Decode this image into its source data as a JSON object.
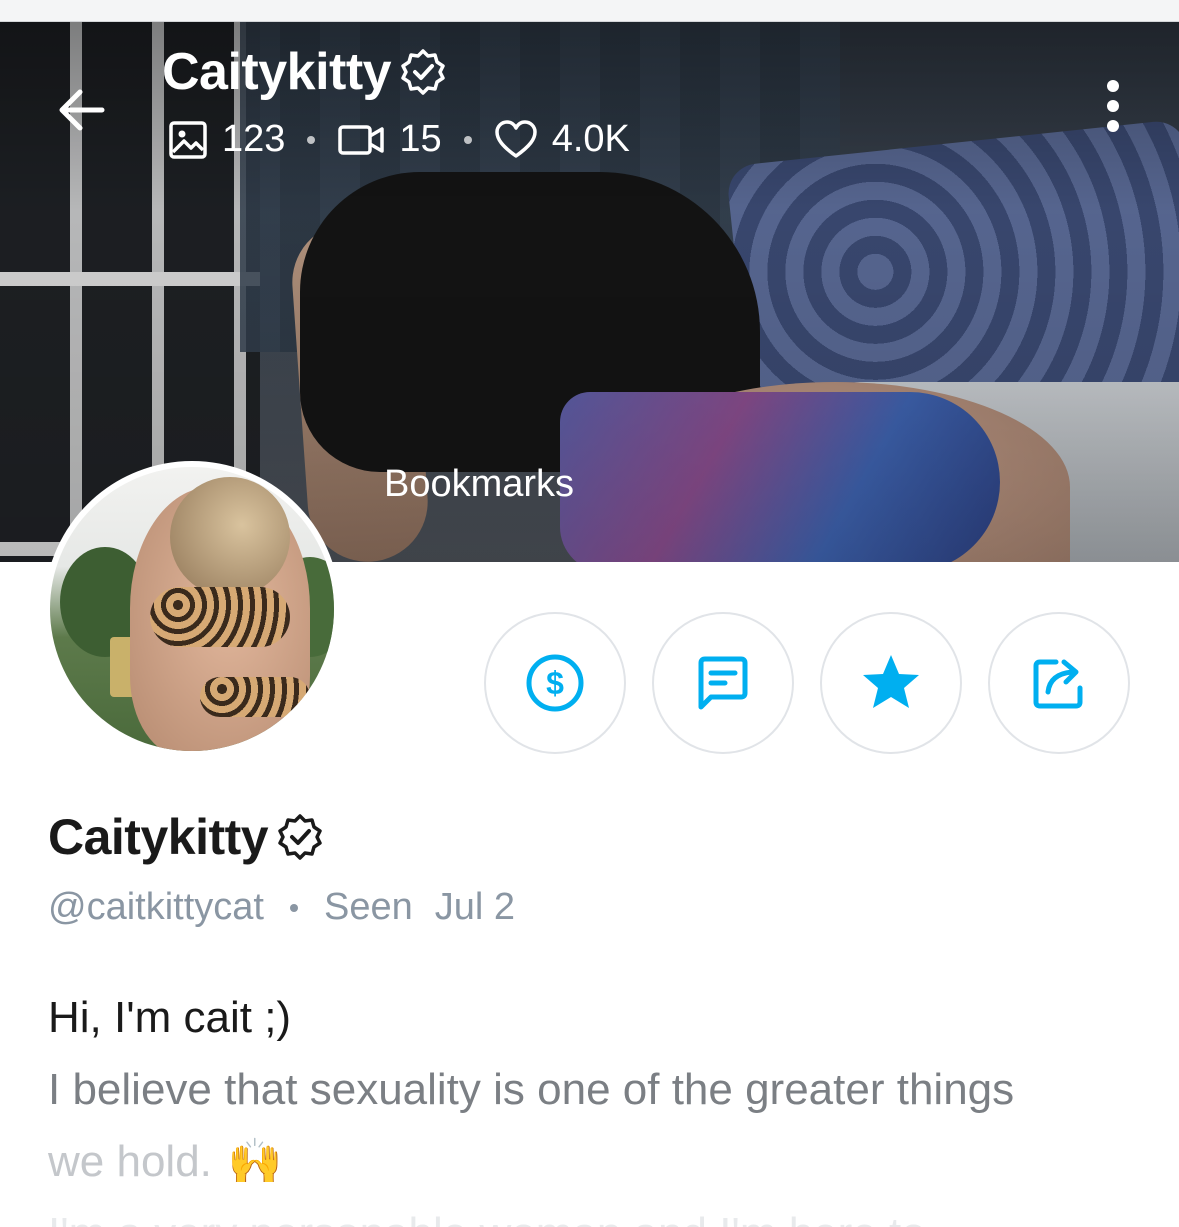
{
  "header": {
    "display_name": "Caitykitty",
    "stats": {
      "photos": "123",
      "videos": "15",
      "likes": "4.0K"
    }
  },
  "cover": {
    "overlay_label": "Bookmarks"
  },
  "actions": [
    {
      "name": "tip",
      "icon": "dollar-circle-icon"
    },
    {
      "name": "message",
      "icon": "message-icon"
    },
    {
      "name": "favorite",
      "icon": "star-icon"
    },
    {
      "name": "share",
      "icon": "share-icon"
    }
  ],
  "profile": {
    "display_name": "Caitykitty",
    "username": "@caitkittycat",
    "seen_label": "Seen",
    "seen_date": "Jul 2",
    "bio_line1": "Hi, I'm cait ;)",
    "bio_line2": "I believe that sexuality is one of the greater things",
    "bio_line3": "we hold.",
    "bio_emoji": "🙌",
    "bio_line4": "I'm a very personable woman and I'm here to"
  },
  "colors": {
    "accent": "#00aff0",
    "muted": "#8a96a3",
    "text": "#1a1a1a"
  }
}
